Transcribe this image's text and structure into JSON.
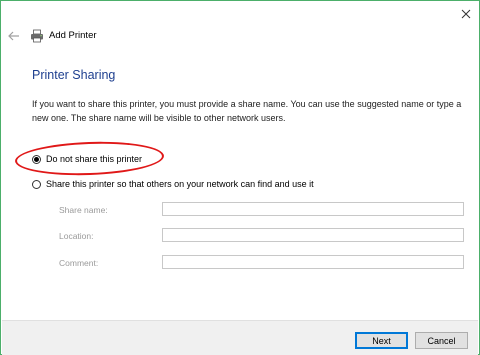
{
  "window": {
    "title": "Add Printer",
    "close_icon": "close-icon",
    "back_icon": "back-arrow-icon",
    "app_icon": "printer-icon"
  },
  "page": {
    "heading": "Printer Sharing",
    "description": "If you want to share this printer, you must provide a share name. You can use the suggested name or type a new one. The share name will be visible to other network users."
  },
  "options": {
    "do_not_share": {
      "label": "Do not share this printer",
      "selected": true
    },
    "share": {
      "label": "Share this printer so that others on your network can find and use it",
      "selected": false
    }
  },
  "fields": {
    "share_name": {
      "label": "Share name:",
      "value": ""
    },
    "location": {
      "label": "Location:",
      "value": ""
    },
    "comment": {
      "label": "Comment:",
      "value": ""
    }
  },
  "buttons": {
    "next": "Next",
    "cancel": "Cancel"
  },
  "colors": {
    "heading": "#1e3f8f",
    "annotation": "#e01818",
    "primary_border": "#0078d7"
  }
}
